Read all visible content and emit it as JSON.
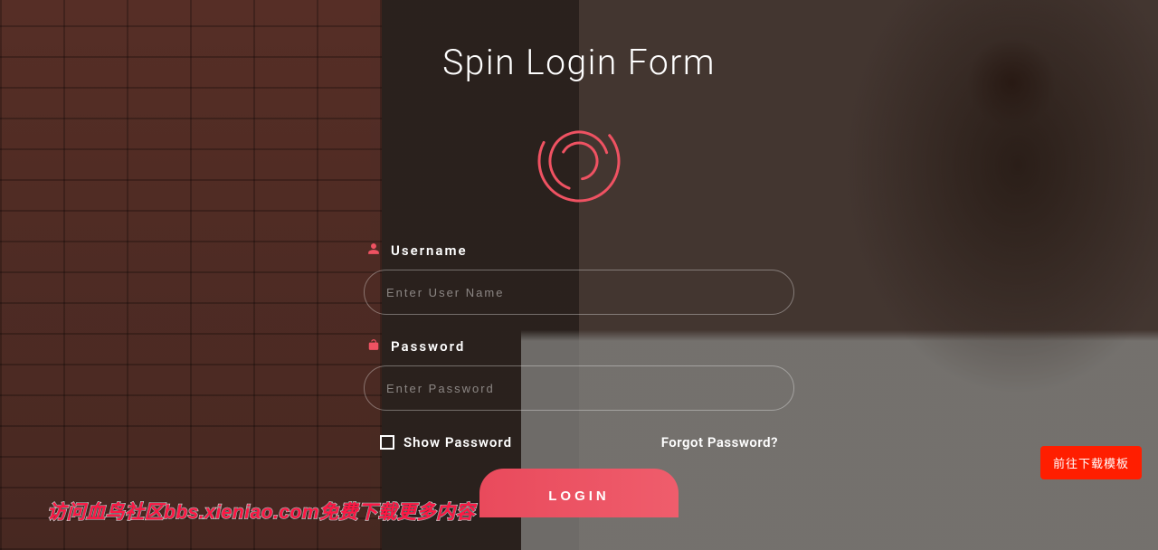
{
  "title": "Spin Login Form",
  "fields": {
    "username": {
      "label": "Username",
      "placeholder": "Enter User Name"
    },
    "password": {
      "label": "Password",
      "placeholder": "Enter Password"
    }
  },
  "options": {
    "show_password": "Show Password",
    "forgot": "Forgot Password?"
  },
  "actions": {
    "login": "LOGIN"
  },
  "promo_button": "前往下载模板",
  "watermark": "访问血鸟社区bbs.xieniao.com免费下载更多内容",
  "colors": {
    "accent": "#ef5262",
    "promo": "#ff1e00"
  }
}
